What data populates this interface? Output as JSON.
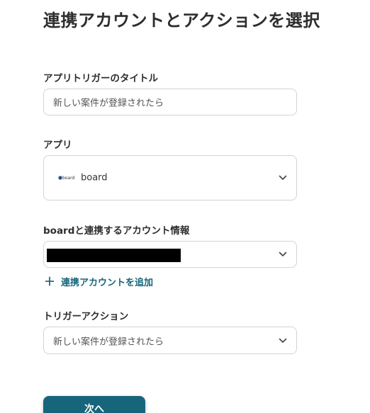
{
  "page": {
    "title": "連携アカウントとアクションを選択"
  },
  "trigger_title": {
    "label": "アプリトリガーのタイトル",
    "value": "新しい案件が登録されたら"
  },
  "app": {
    "label": "アプリ",
    "name": "board",
    "logo_text": "board",
    "icon": "board-logo-icon"
  },
  "account": {
    "label": "boardと連携するアカウント情報",
    "add_link": "連携アカウントを追加",
    "add_icon": "plus-icon"
  },
  "trigger_action": {
    "label": "トリガーアクション",
    "value": "新しい案件が登録されたら"
  },
  "next_button": {
    "label": "次へ"
  },
  "colors": {
    "accent": "#17657a",
    "border": "#cfd4da"
  }
}
